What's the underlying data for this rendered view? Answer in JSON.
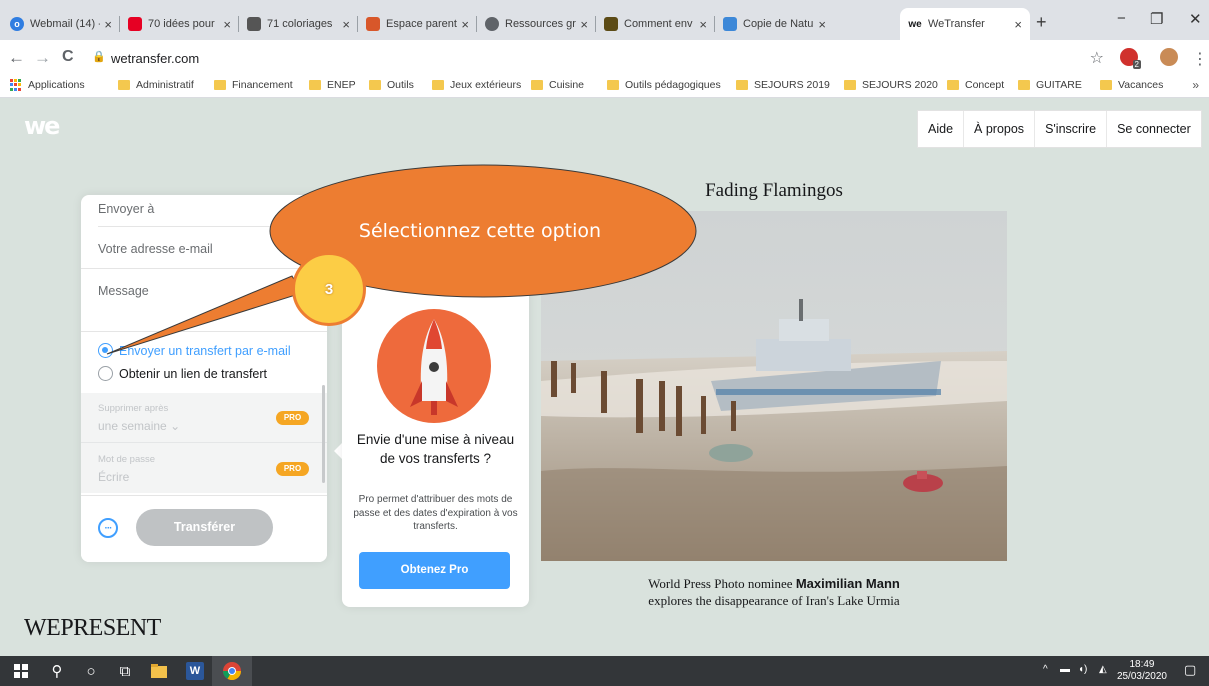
{
  "tabs": [
    {
      "title": "Webmail (14) -",
      "icon": "webmail-icon",
      "color": "#2f7de1",
      "active": false
    },
    {
      "title": "70 idées pour",
      "icon": "pinterest-icon",
      "color": "#e60023",
      "active": false
    },
    {
      "title": "71 coloriages",
      "icon": "coloring-icon",
      "color": "#555555",
      "active": false
    },
    {
      "title": "Espace parent",
      "icon": "parent-icon",
      "color": "#d8572a",
      "active": false
    },
    {
      "title": "Ressources gra",
      "icon": "globe-icon",
      "color": "#5f6368",
      "active": false
    },
    {
      "title": "Comment env",
      "icon": "video-icon",
      "color": "#5c4b16",
      "active": false
    },
    {
      "title": "Copie de Natu",
      "icon": "docs-icon",
      "color": "#3d88d8",
      "active": false
    },
    {
      "title": "WeTransfer",
      "icon": "wetransfer-icon",
      "color": "#17181a",
      "active": true
    }
  ],
  "browser": {
    "url": "wetransfer.com",
    "close_glyph": "×",
    "new_tab_glyph": "+",
    "minimize_glyph": "−",
    "restore_glyph": "❐",
    "window_close_glyph": "✕",
    "back_glyph": "←",
    "forward_glyph": "→",
    "reload_glyph": "C",
    "star_glyph": "☆",
    "menu_glyph": "⋮",
    "ext_badge": "2"
  },
  "bookmarks": {
    "items": [
      {
        "label": "Applications",
        "icon": "apps-icon"
      },
      {
        "label": "Administratif",
        "icon": "folder-icon"
      },
      {
        "label": "Financement",
        "icon": "folder-icon"
      },
      {
        "label": "ENEP",
        "icon": "folder-icon"
      },
      {
        "label": "Outils",
        "icon": "folder-icon"
      },
      {
        "label": "Jeux extérieurs",
        "icon": "folder-icon"
      },
      {
        "label": "Cuisine",
        "icon": "folder-icon"
      },
      {
        "label": "Outils pédagogiques",
        "icon": "folder-icon"
      },
      {
        "label": "SEJOURS 2019",
        "icon": "folder-icon"
      },
      {
        "label": "SEJOURS 2020",
        "icon": "folder-icon"
      },
      {
        "label": "Concept",
        "icon": "folder-icon"
      },
      {
        "label": "GUITARE",
        "icon": "folder-icon"
      },
      {
        "label": "Vacances",
        "icon": "folder-icon"
      }
    ],
    "more": "»"
  },
  "site": {
    "logo": "we",
    "nav": [
      "Aide",
      "À propos",
      "S'inscrire",
      "Se connecter"
    ]
  },
  "transfer_panel": {
    "send_to": "Envoyer à",
    "your_email": "Votre adresse e-mail",
    "message": "Message",
    "option_email": "Envoyer un transfert par e-mail",
    "option_link": "Obtenir un lien de transfert",
    "delete_after_label": "Supprimer après",
    "delete_after_value": "une semaine",
    "password_label": "Mot de passe",
    "password_value": "Écrire",
    "pro_badge": "PRO",
    "more_glyph": "···",
    "transfer_button": "Transférer",
    "chevron": "⌄"
  },
  "promo": {
    "title": "Envie d'une mise à niveau de vos transferts ?",
    "text": "Pro permet d'attribuer des mots de passe et des dates d'expiration à vos transferts.",
    "button": "Obtenez Pro"
  },
  "annotation": {
    "text": "Sélectionnez cette option",
    "step": "3",
    "fill": "#ed7d31"
  },
  "feature": {
    "title": "Fading Flamingos",
    "caption_prefix": "World Press Photo nominee",
    "caption_name": "Maximilian Mann",
    "caption_suffix": "explores the disappearance of Iran's Lake Urmia",
    "brand": "WEPRESENT"
  },
  "taskbar": {
    "time": "18:49",
    "date": "25/03/2020",
    "search_glyph": "⚲",
    "cortana_glyph": "○",
    "task_view_glyph": "⧉",
    "word_glyph": "W",
    "tray_glyph": "^",
    "notif_glyph": "▢",
    "volume_glyph": "◖)",
    "network_glyph": "◭",
    "battery_glyph": "▬"
  }
}
